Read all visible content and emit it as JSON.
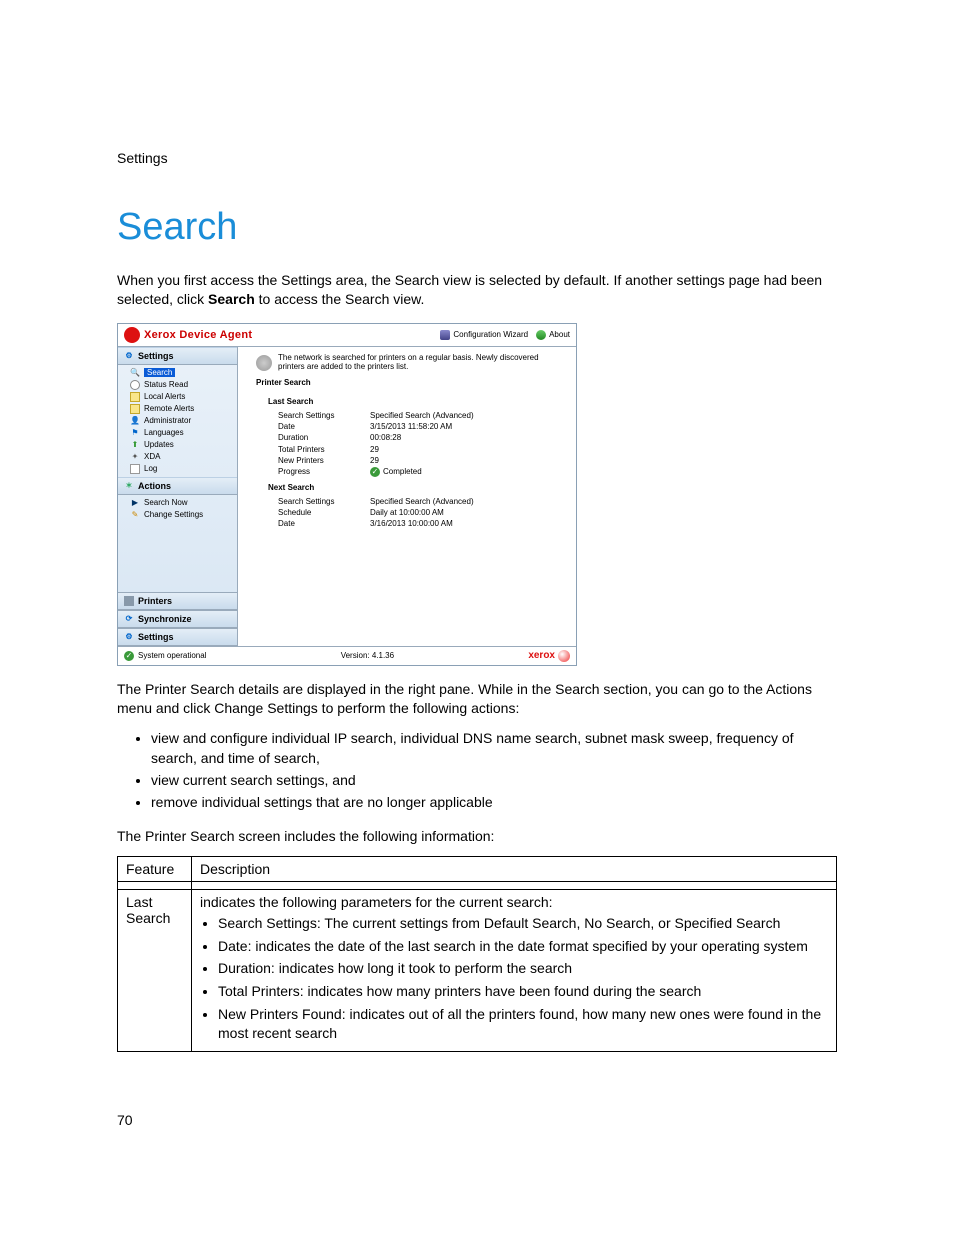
{
  "page": {
    "breadcrumb": "Settings",
    "title": "Search",
    "intro_pre": "When you first access the Settings area, the Search view is selected by default. If another settings page had been selected, click ",
    "intro_bold": "Search",
    "intro_post": " to access the Search view.",
    "below1": "The Printer Search details are displayed in the right pane. While in the Search section, you can go to the Actions menu and click Change Settings to perform the following actions:",
    "bullets": [
      "view and configure individual IP search, individual DNS name search, subnet mask sweep, frequency of search, and time of search,",
      "view current search settings, and",
      "remove individual settings that are no longer applicable"
    ],
    "table_intro": "The Printer Search screen includes the following information:",
    "page_number": "70"
  },
  "shot": {
    "brand": "Xerox Device Agent",
    "top_links": {
      "config": "Configuration Wizard",
      "about": "About"
    },
    "sidebar": {
      "settings_header": "Settings",
      "items": [
        {
          "icon": "search-icon",
          "label": "Search",
          "selected": true
        },
        {
          "icon": "dashboard-icon",
          "label": "Status Read"
        },
        {
          "icon": "envelope-icon",
          "label": "Local Alerts"
        },
        {
          "icon": "envelope-icon",
          "label": "Remote Alerts"
        },
        {
          "icon": "admin-icon",
          "label": "Administrator"
        },
        {
          "icon": "flag-icon",
          "label": "Languages"
        },
        {
          "icon": "updates-icon",
          "label": "Updates"
        },
        {
          "icon": "xda-icon",
          "label": "XDA"
        },
        {
          "icon": "log-icon",
          "label": "Log"
        }
      ],
      "actions_header": "Actions",
      "actions": [
        {
          "icon": "play-icon",
          "label": "Search Now"
        },
        {
          "icon": "pencil-icon",
          "label": "Change Settings"
        }
      ],
      "bottom": [
        {
          "icon": "printer-icon",
          "label": "Printers"
        },
        {
          "icon": "sync-icon",
          "label": "Synchronize"
        },
        {
          "icon": "gear-icon",
          "label": "Settings"
        }
      ]
    },
    "content": {
      "description": "The network is searched for printers on a regular basis. Newly discovered printers are added to the printers list.",
      "section_title": "Printer Search",
      "last_search": {
        "heading": "Last Search",
        "rows": [
          {
            "k": "Search Settings",
            "v": "Specified Search (Advanced)"
          },
          {
            "k": "Date",
            "v": "3/15/2013 11:58:20 AM"
          },
          {
            "k": "Duration",
            "v": "00:08:28"
          },
          {
            "k": "Total Printers",
            "v": "29"
          },
          {
            "k": "New Printers",
            "v": "29"
          },
          {
            "k": "Progress",
            "v": "Completed",
            "ok": true
          }
        ]
      },
      "next_search": {
        "heading": "Next Search",
        "rows": [
          {
            "k": "Search Settings",
            "v": "Specified Search  (Advanced)"
          },
          {
            "k": "Schedule",
            "v": "Daily at 10:00:00 AM"
          },
          {
            "k": "Date",
            "v": "3/16/2013 10:00:00 AM"
          }
        ]
      }
    },
    "status": {
      "text": "System operational",
      "version": "Version: 4.1.36",
      "logo": "xerox"
    }
  },
  "table": {
    "h1": "Feature",
    "h2": "Description",
    "r1c1": "Last Search",
    "r1_intro": "indicates the following parameters for the current search:",
    "r1_items": [
      "Search Settings: The current settings from Default Search, No Search, or Specified Search",
      "Date: indicates the date of the last search in the date format specified by your operating system",
      "Duration: indicates how long it took to perform the search",
      "Total Printers: indicates how many printers have been found during the search",
      "New Printers Found: indicates out of all the printers found, how many new ones were found in the most recent search"
    ]
  }
}
